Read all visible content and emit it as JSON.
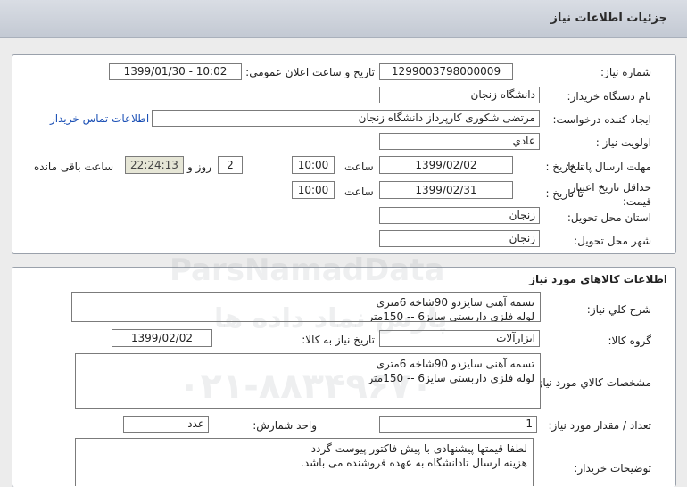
{
  "header": {
    "title": "جزئیات اطلاعات نیاز"
  },
  "labels": {
    "need_number": "شماره نیاز:",
    "announce_datetime": "تاریخ و ساعت اعلان عمومی:",
    "buyer_org": "نام دستگاه خریدار:",
    "requester": "ایجاد کننده درخواست:",
    "priority": "اولویت نیاز :",
    "deadline": "مهلت ارسال پاسخ:",
    "to_date": "تا تاریخ :",
    "time": "ساعت",
    "day_and": "روز و",
    "remaining": "ساعت باقی مانده",
    "min_validity": "حداقل تاریخ اعتبار قیمت:",
    "to_date2": "تا تاریخ :",
    "time2": "ساعت",
    "province": "استان محل تحویل:",
    "city": "شهر محل تحویل:",
    "general_desc": "شرح کلي نياز:",
    "goods_group": "گروه کالا:",
    "need_date": "تاریخ نیاز به کالا:",
    "goods_specs": "مشخصات کالاي مورد نياز:",
    "quantity": "تعداد / مقدار مورد نیاز:",
    "unit": "واحد شمارش:",
    "buyer_notes": "توضیحات خریدار:"
  },
  "values": {
    "need_number": "1299003798000009",
    "announce_datetime": "1399/01/30 - 10:02",
    "buyer_org": "دانشگاه زنجان",
    "requester": "مرتضی شکوری کارپرداز دانشگاه زنجان",
    "contact_link": "اطلاعات تماس خریدار",
    "priority": "عادي",
    "deadline_date": "1399/02/02",
    "deadline_time": "10:00",
    "days": "2",
    "remaining_time": "22:24:13",
    "validity_date": "1399/02/31",
    "validity_time": "10:00",
    "province": "زنجان",
    "city": "زنجان",
    "general_desc": "تسمه آهنی سایزدو  90شاخه 6متری\nلوله فلزی داربستی سایز6 -- 150متر",
    "goods_group": "ابزارآلات",
    "need_date": "1399/02/02",
    "goods_specs": "تسمه آهنی سایزدو  90شاخه 6متری\nلوله فلزی داربستی سایز6 -- 150متر",
    "quantity": "1",
    "unit": "عدد",
    "buyer_notes": "لطفا قیمتها پیشنهادی با پیش فاکتور پیوست گردد\nهزینه ارسال تادانشگاه به عهده فروشنده می باشد."
  },
  "section": {
    "goods_info_title": "اطلاعات کالاهاي مورد نياز"
  },
  "watermark": {
    "brand": "ParsNamadData",
    "persian": "پارس نماد داده ها",
    "phone": "۰۲۱-۸۸۳۴۹۶۷۰"
  }
}
